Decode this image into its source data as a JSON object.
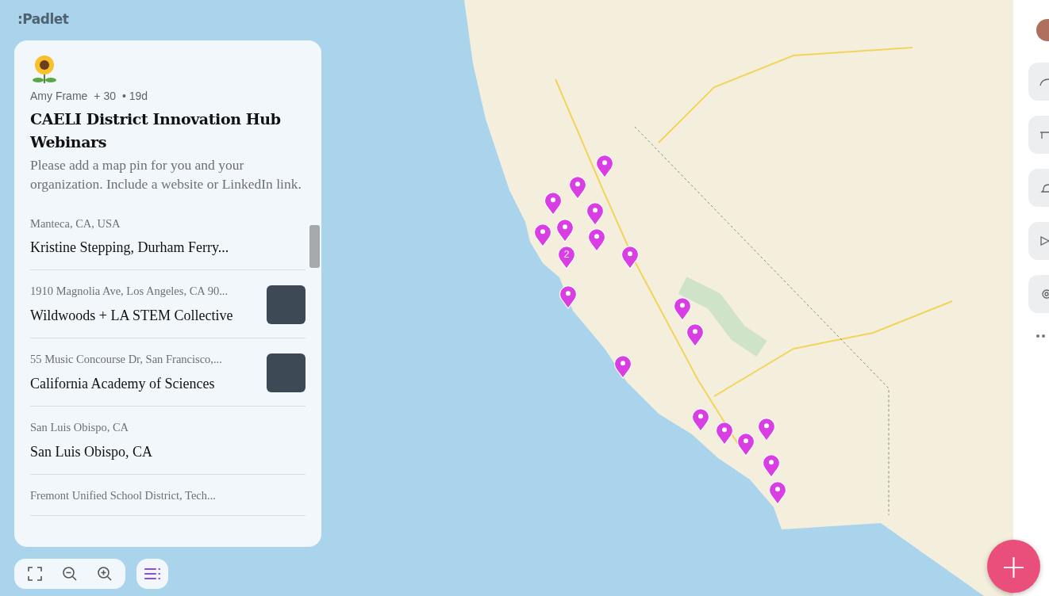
{
  "app": {
    "logo": ":Padlet"
  },
  "board": {
    "author": "Amy Frame",
    "contributors": "+ 30",
    "age": "• 19d",
    "title": "CAELI District Innovation Hub Webinars",
    "description": "Please add a map pin for you and your organization. Include a website or LinkedIn link."
  },
  "posts": [
    {
      "subtitle": "Manteca, CA, USA",
      "title": "Kristine Stepping, Durham Ferry...",
      "thumbnail": false
    },
    {
      "subtitle": "1910 Magnolia Ave, Los Angeles, CA 90...",
      "title": "Wildwoods + LA STEM Collective",
      "thumbnail": true
    },
    {
      "subtitle": "55 Music Concourse Dr, San Francisco,...",
      "title": "California Academy of Sciences",
      "thumbnail": true
    },
    {
      "subtitle": "San Luis Obispo, CA",
      "title": "San Luis Obispo, CA",
      "thumbnail": false
    },
    {
      "subtitle": "Fremont Unified School District, Tech...",
      "thumbnail": false
    }
  ],
  "map": {
    "clusters": [
      "2"
    ]
  },
  "add_button": {
    "label": "+"
  }
}
